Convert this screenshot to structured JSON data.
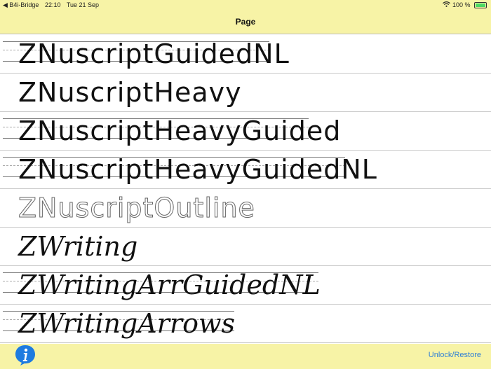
{
  "status_bar": {
    "back_app": "◀ B4i-Bridge",
    "time": "22:10",
    "date": "Tue 21 Sep",
    "battery": "100 %",
    "battery_level": 1.0
  },
  "nav": {
    "title": "Page"
  },
  "fonts": [
    {
      "label": "ZNuscriptGuidedNL",
      "style": "guided"
    },
    {
      "label": "ZNuscriptHeavy",
      "style": "plain"
    },
    {
      "label": "ZNuscriptHeavyGuided",
      "style": "guided"
    },
    {
      "label": "ZNuscriptHeavyGuidedNL",
      "style": "guided"
    },
    {
      "label": "ZNuscriptOutline",
      "style": "outline"
    },
    {
      "label": "ZWriting",
      "style": "script"
    },
    {
      "label": "ZWritingArrGuidedNL",
      "style": "script-guided"
    },
    {
      "label": "ZWritingArrows",
      "style": "script-guided"
    }
  ],
  "toolbar": {
    "info_icon": "info-icon",
    "unlock_label": "Unlock/Restore"
  },
  "colors": {
    "background": "#f7f3a6",
    "accent": "#2f7fd6",
    "info": "#1e7be0"
  }
}
